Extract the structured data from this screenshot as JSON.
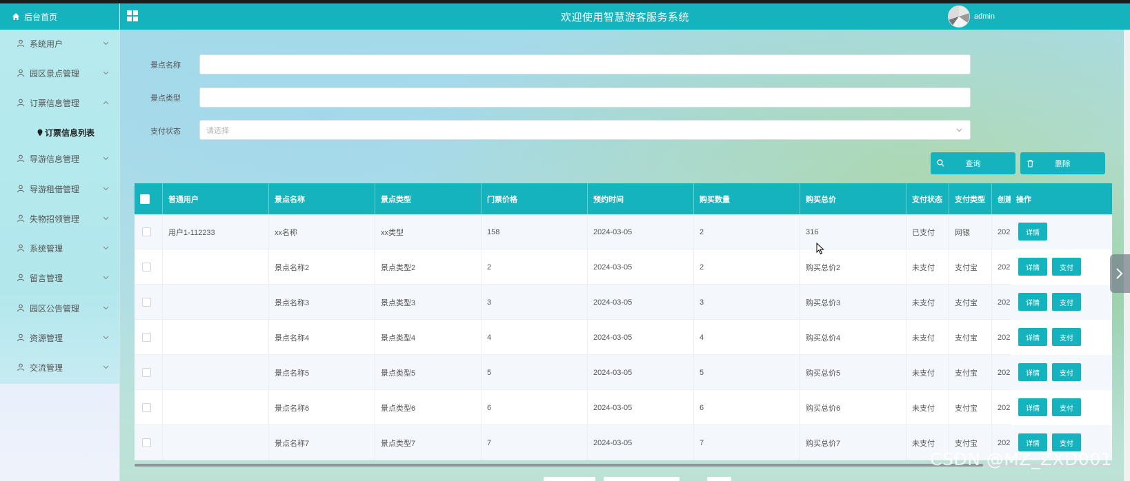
{
  "sidebar": {
    "home_label": "后台首页",
    "items": [
      {
        "label": "系统用户"
      },
      {
        "label": "园区景点管理"
      },
      {
        "label": "订票信息管理"
      },
      {
        "label": "导游信息管理"
      },
      {
        "label": "导游租借管理"
      },
      {
        "label": "失物招领管理"
      },
      {
        "label": "系统管理"
      },
      {
        "label": "留言管理"
      },
      {
        "label": "园区公告管理"
      },
      {
        "label": "资源管理"
      },
      {
        "label": "交流管理"
      }
    ],
    "active_sub": "订票信息列表"
  },
  "header": {
    "title": "欢迎使用智慧游客服务系统",
    "username": "admin"
  },
  "search": {
    "fields": [
      {
        "label": "景点名称",
        "value": ""
      },
      {
        "label": "景点类型",
        "value": ""
      },
      {
        "label": "支付状态",
        "placeholder": "请选择"
      }
    ],
    "query_button": "查询",
    "delete_button": "删除"
  },
  "table": {
    "headers": [
      "普通用户",
      "景点名称",
      "景点类型",
      "门票价格",
      "预约时间",
      "购买数量",
      "购买总价",
      "支付状态",
      "支付类型",
      "创建",
      "操作"
    ],
    "rows": [
      {
        "user": "用户1-112233",
        "name": "xx名称",
        "type": "xx类型",
        "price": "158",
        "date": "2024-03-05",
        "qty": "2",
        "total": "316",
        "status": "已支付",
        "paytype": "网银",
        "created": "202",
        "actions": [
          "详情"
        ]
      },
      {
        "user": "",
        "name": "景点名称2",
        "type": "景点类型2",
        "price": "2",
        "date": "2024-03-05",
        "qty": "2",
        "total": "购买总价2",
        "status": "未支付",
        "paytype": "支付宝",
        "created": "202",
        "actions": [
          "详情",
          "支付"
        ]
      },
      {
        "user": "",
        "name": "景点名称3",
        "type": "景点类型3",
        "price": "3",
        "date": "2024-03-05",
        "qty": "3",
        "total": "购买总价3",
        "status": "未支付",
        "paytype": "支付宝",
        "created": "202",
        "actions": [
          "详情",
          "支付"
        ]
      },
      {
        "user": "",
        "name": "景点名称4",
        "type": "景点类型4",
        "price": "4",
        "date": "2024-03-05",
        "qty": "4",
        "total": "购买总价4",
        "status": "未支付",
        "paytype": "支付宝",
        "created": "202",
        "actions": [
          "详情",
          "支付"
        ]
      },
      {
        "user": "",
        "name": "景点名称5",
        "type": "景点类型5",
        "price": "5",
        "date": "2024-03-05",
        "qty": "5",
        "total": "购买总价5",
        "status": "未支付",
        "paytype": "支付宝",
        "created": "202",
        "actions": [
          "详情",
          "支付"
        ]
      },
      {
        "user": "",
        "name": "景点名称6",
        "type": "景点类型6",
        "price": "6",
        "date": "2024-03-05",
        "qty": "6",
        "total": "购买总价6",
        "status": "未支付",
        "paytype": "支付宝",
        "created": "202",
        "actions": [
          "详情",
          "支付"
        ]
      },
      {
        "user": "",
        "name": "景点名称7",
        "type": "景点类型7",
        "price": "7",
        "date": "2024-03-05",
        "qty": "7",
        "total": "购买总价7",
        "status": "未支付",
        "paytype": "支付宝",
        "created": "202",
        "actions": [
          "详情",
          "支付"
        ]
      }
    ]
  },
  "watermark": "CSDN @MZ_ZXD001",
  "colors": {
    "primary": "#15b3be",
    "header_bg": "#15b3be"
  },
  "icons": [
    "home-icon",
    "user-icon",
    "chevron-down-icon",
    "chevron-up-icon",
    "location-pin-icon",
    "grid-icon",
    "search-icon",
    "trash-icon",
    "chevron-right-icon"
  ]
}
